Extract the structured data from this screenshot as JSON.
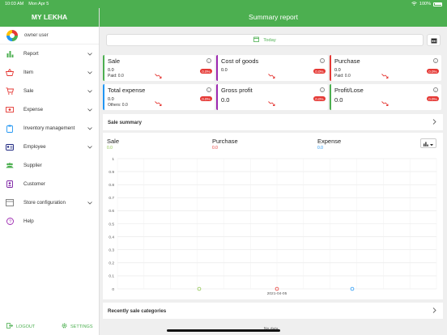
{
  "statusbar": {
    "time": "10:03 AM",
    "date": "Mon Apr 5",
    "battery": "100%"
  },
  "sidebar": {
    "app_title": "MY LEKHA",
    "user": "owner user",
    "items": [
      {
        "label": "Report",
        "icon": "bar-chart-icon",
        "has_chevron": true
      },
      {
        "label": "Item",
        "icon": "basket-icon",
        "has_chevron": true
      },
      {
        "label": "Sale",
        "icon": "cart-icon",
        "has_chevron": true
      },
      {
        "label": "Expense",
        "icon": "money-icon",
        "has_chevron": true
      },
      {
        "label": "Inventory management",
        "icon": "clipboard-icon",
        "has_chevron": true
      },
      {
        "label": "Employee",
        "icon": "id-card-icon",
        "has_chevron": true
      },
      {
        "label": "Supplier",
        "icon": "people-icon",
        "has_chevron": false
      },
      {
        "label": "Customer",
        "icon": "contact-icon",
        "has_chevron": false
      },
      {
        "label": "Store configuration",
        "icon": "store-icon",
        "has_chevron": true
      },
      {
        "label": "Help",
        "icon": "help-icon",
        "has_chevron": false
      }
    ],
    "logout_label": "LOGOUT",
    "settings_label": "SETTINGS"
  },
  "main": {
    "title": "Summary report",
    "date_filter": "Today"
  },
  "cards": [
    {
      "title": "Sale",
      "value": "0.0",
      "sub": "Paid: 0.0",
      "badge": "0.0%",
      "color": "#4caf50"
    },
    {
      "title": "Cost of goods",
      "value": "0.0",
      "sub": "",
      "badge": "0.0%",
      "color": "#9c27b0"
    },
    {
      "title": "Purchase",
      "value": "0.0",
      "sub": "Paid: 0.0",
      "badge": "0.0%",
      "color": "#e53935"
    },
    {
      "title": "Total expense",
      "value": "0.0",
      "sub": "Others: 0.0",
      "badge": "0.0%",
      "color": "#2196f3"
    },
    {
      "title": "Gross profit",
      "value": "0.0",
      "sub": "",
      "badge": "0.0%",
      "color": "#9c27b0"
    },
    {
      "title": "Profit/Lose",
      "value": "0.0",
      "sub": "",
      "badge": "0.0%",
      "color": "#4caf50"
    }
  ],
  "sale_summary": {
    "label": "Sale summary"
  },
  "recent_categories": {
    "label": "Recently sale categories",
    "empty_text": "No data"
  },
  "chart_data": {
    "type": "line",
    "x": [
      "2021-04-05"
    ],
    "series": [
      {
        "name": "Sale",
        "total": "0.0",
        "color": "#8bc34a",
        "values": [
          0
        ]
      },
      {
        "name": "Purchase",
        "total": "0.0",
        "color": "#e53935",
        "values": [
          0
        ]
      },
      {
        "name": "Expense",
        "total": "0.0",
        "color": "#2196f3",
        "values": [
          0
        ]
      }
    ],
    "yticks": [
      "1",
      "0.9",
      "0.8",
      "0.7",
      "0.6",
      "0.5",
      "0.4",
      "0.3",
      "0.2",
      "0.1",
      "0"
    ],
    "ylim": [
      0,
      1
    ],
    "grid": true
  }
}
